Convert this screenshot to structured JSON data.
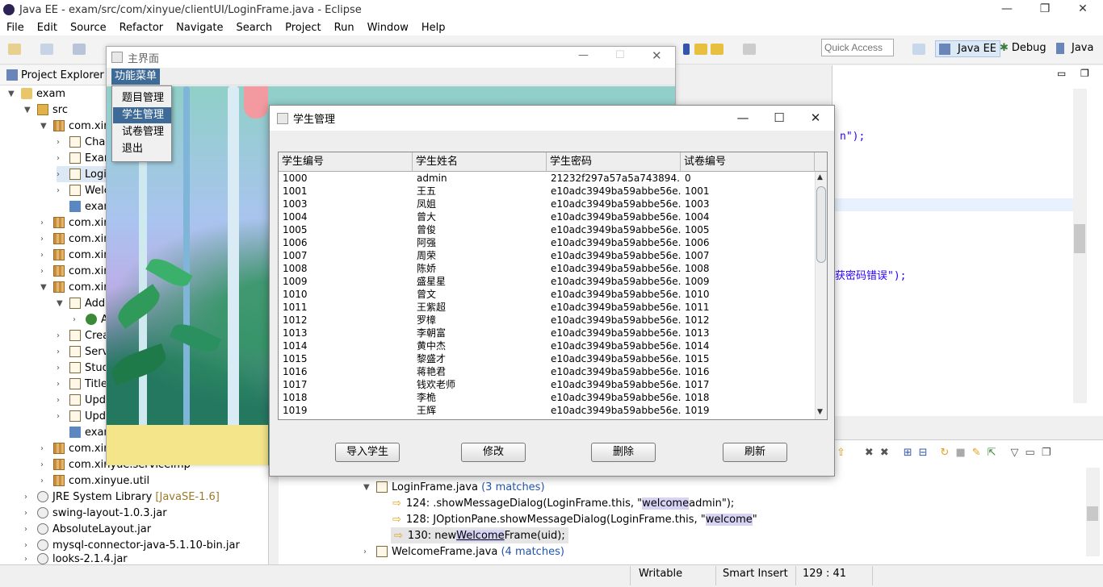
{
  "window": {
    "title": "Java EE - exam/src/com/xinyue/clientUI/LoginFrame.java - Eclipse"
  },
  "menubar": [
    "File",
    "Edit",
    "Source",
    "Refactor",
    "Navigate",
    "Search",
    "Project",
    "Run",
    "Window",
    "Help"
  ],
  "toolbar": {
    "quick_access_placeholder": "Quick Access"
  },
  "perspectives": {
    "java_ee": "Java EE",
    "debug": "Debug",
    "java": "Java"
  },
  "project_explorer": {
    "title": "Project Explorer",
    "rows": [
      {
        "label": "exam"
      },
      {
        "label": "src"
      },
      {
        "label": "com.xin"
      },
      {
        "label": "Char"
      },
      {
        "label": "Exam"
      },
      {
        "label": "Logi"
      },
      {
        "label": "Welc"
      },
      {
        "label": "exan"
      },
      {
        "label": "com.xin"
      },
      {
        "label": "com.xin"
      },
      {
        "label": "com.xin"
      },
      {
        "label": "com.xin"
      },
      {
        "label": "com.xin"
      },
      {
        "label": "Add"
      },
      {
        "label": "A"
      },
      {
        "label": "Crea"
      },
      {
        "label": "Serv"
      },
      {
        "label": "Stud"
      },
      {
        "label": "Title"
      },
      {
        "label": "Upd"
      },
      {
        "label": "Upd"
      },
      {
        "label": "exan"
      },
      {
        "label": "com.xin"
      },
      {
        "label": "com.xinyue.serviceImp"
      },
      {
        "label": "com.xinyue.util"
      },
      {
        "label": "JRE System Library",
        "suffix": "[JavaSE-1.6]"
      },
      {
        "label": "swing-layout-1.0.3.jar"
      },
      {
        "label": "AbsoluteLayout.jar"
      },
      {
        "label": "mysql-connector-java-5.1.10-bin.jar"
      },
      {
        "label": "looks-2.1.4.jar"
      }
    ]
  },
  "editor": {
    "line1": "n\");",
    "line2": "获密码错误\");"
  },
  "search": {
    "file1": "LoginFrame.java",
    "file1_matches": "(3 matches)",
    "m1_prefix": "124: .showMessageDialog(LoginFrame.this, \"",
    "m1_hl": "welcome",
    "m1_suffix": " admin\");",
    "m2_prefix": "128: JOptionPane.showMessageDialog(LoginFrame.this, \"",
    "m2_hl": "welcome",
    "m2_suffix": " \"",
    "m3_prefix": "130: new ",
    "m3_hl": "Welcome",
    "m3_suffix": "Frame(uid);",
    "file2": "WelcomeFrame.java",
    "file2_matches": "(4 matches)"
  },
  "status": {
    "writable": "Writable",
    "insert": "Smart Insert",
    "position": "129 : 41"
  },
  "main_frame": {
    "title": "主界面",
    "menu_label": "功能菜单",
    "dropdown": [
      "题目管理",
      "学生管理",
      "试卷管理",
      "退出"
    ]
  },
  "dialog": {
    "title": "学生管理",
    "columns": [
      "学生编号",
      "学生姓名",
      "学生密码",
      "试卷编号"
    ],
    "rows": [
      [
        "1000",
        "admin",
        "21232f297a57a5a743894...",
        "0"
      ],
      [
        "1001",
        "王五",
        "e10adc3949ba59abbe56e...",
        "1001"
      ],
      [
        "1003",
        "凤姐",
        "e10adc3949ba59abbe56e...",
        "1003"
      ],
      [
        "1004",
        "曾大",
        "e10adc3949ba59abbe56e...",
        "1004"
      ],
      [
        "1005",
        "曾俊",
        "e10adc3949ba59abbe56e...",
        "1005"
      ],
      [
        "1006",
        "阿强",
        "e10adc3949ba59abbe56e...",
        "1006"
      ],
      [
        "1007",
        "周荣",
        "e10adc3949ba59abbe56e...",
        "1007"
      ],
      [
        "1008",
        "陈娇",
        "e10adc3949ba59abbe56e...",
        "1008"
      ],
      [
        "1009",
        "盛星星",
        "e10adc3949ba59abbe56e...",
        "1009"
      ],
      [
        "1010",
        "曾文",
        "e10adc3949ba59abbe56e...",
        "1010"
      ],
      [
        "1011",
        "王紫超",
        "e10adc3949ba59abbe56e...",
        "1011"
      ],
      [
        "1012",
        "罗樟",
        "e10adc3949ba59abbe56e...",
        "1012"
      ],
      [
        "1013",
        "李朝富",
        "e10adc3949ba59abbe56e...",
        "1013"
      ],
      [
        "1014",
        "黄中杰",
        "e10adc3949ba59abbe56e...",
        "1014"
      ],
      [
        "1015",
        "黎盛才",
        "e10adc3949ba59abbe56e...",
        "1015"
      ],
      [
        "1016",
        "蒋艳君",
        "e10adc3949ba59abbe56e...",
        "1016"
      ],
      [
        "1017",
        "钱欢老师",
        "e10adc3949ba59abbe56e...",
        "1017"
      ],
      [
        "1018",
        "李桅",
        "e10adc3949ba59abbe56e...",
        "1018"
      ],
      [
        "1019",
        "王辉",
        "e10adc3949ba59abbe56e...",
        "1019"
      ]
    ],
    "buttons": {
      "import": "导入学生",
      "edit": "修改",
      "delete": "删除",
      "refresh": "刷新"
    }
  }
}
